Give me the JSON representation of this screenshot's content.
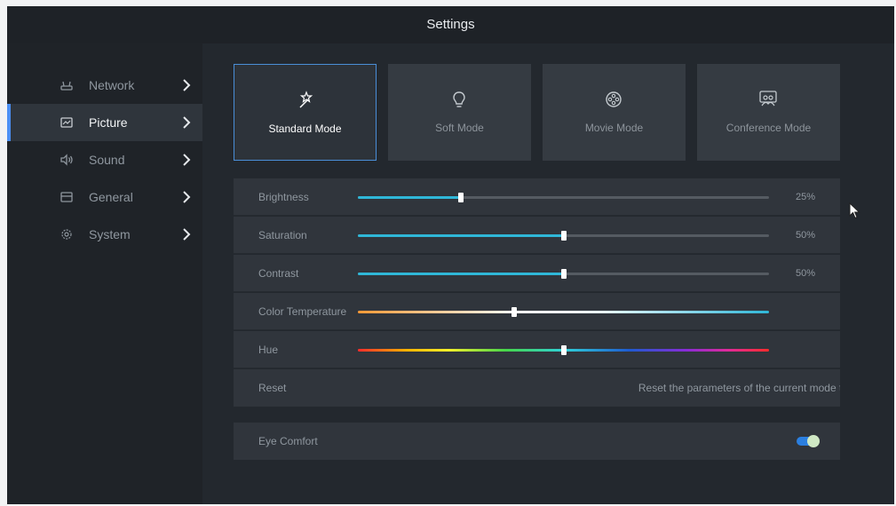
{
  "header": {
    "title": "Settings"
  },
  "sidebar": {
    "items": [
      {
        "label": "Network",
        "icon": "router-icon"
      },
      {
        "label": "Picture",
        "icon": "picture-icon",
        "active": true
      },
      {
        "label": "Sound",
        "icon": "speaker-icon"
      },
      {
        "label": "General",
        "icon": "window-icon"
      },
      {
        "label": "System",
        "icon": "gear-icon"
      }
    ]
  },
  "modes": [
    {
      "label": "Standard Mode",
      "icon": "magic-wand-icon",
      "active": true
    },
    {
      "label": "Soft Mode",
      "icon": "lightbulb-icon"
    },
    {
      "label": "Movie Mode",
      "icon": "film-reel-icon"
    },
    {
      "label": "Conference Mode",
      "icon": "meeting-people-icon"
    }
  ],
  "adjustments": {
    "brightness": {
      "label": "Brightness",
      "value": "25%",
      "level": 0.25
    },
    "saturation": {
      "label": "Saturation",
      "value": "50%",
      "level": 0.5
    },
    "contrast": {
      "label": "Contrast",
      "value": "50%",
      "level": 0.5
    },
    "color_temperature": {
      "label": "Color Temperature",
      "level": 0.38
    },
    "hue": {
      "label": "Hue",
      "level": 0.5
    }
  },
  "reset": {
    "label": "Reset",
    "description": "Reset the parameters of the current mode to"
  },
  "eye_comfort": {
    "label": "Eye Comfort",
    "enabled": true
  },
  "colors": {
    "accent": "#4b8ff5",
    "slider_fill": "#2fb7d8",
    "toggle_on": "#2b7fe0"
  }
}
